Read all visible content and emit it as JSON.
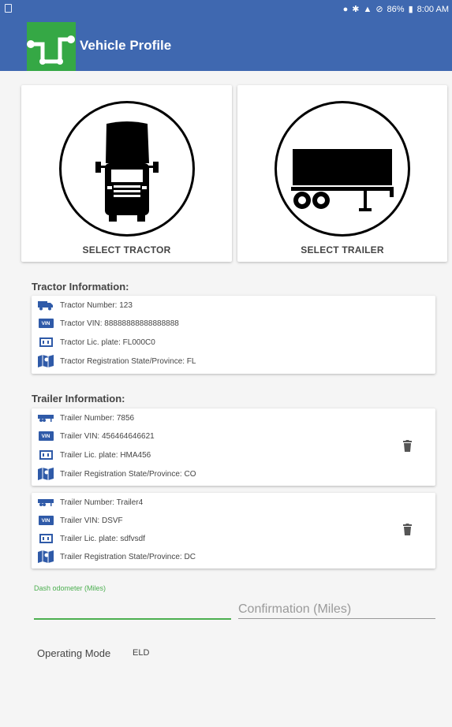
{
  "status_bar": {
    "battery_percent": "86%",
    "time": "8:00 AM",
    "icons": [
      "location-icon",
      "bluetooth-icon",
      "wifi-icon",
      "do-not-disturb-icon",
      "battery-icon"
    ]
  },
  "app_bar": {
    "title": "Vehicle Profile"
  },
  "selectors": {
    "tractor_label": "SELECT TRACTOR",
    "trailer_label": "SELECT TRAILER"
  },
  "tractor_info": {
    "heading": "Tractor Information:",
    "number": "Tractor Number: 123",
    "vin": "Tractor VIN: 88888888888888888",
    "plate": "Tractor Lic. plate: FL000C0",
    "state": "Tractor Registration State/Province: FL"
  },
  "trailer_info": {
    "heading": "Trailer Information:",
    "trailers": [
      {
        "number": "Trailer Number: 7856",
        "vin": "Trailer VIN: 456464646621",
        "plate": "Trailer Lic. plate: HMA456",
        "state": "Trailer Registration State/Province: CO"
      },
      {
        "number": "Trailer Number: Trailer4",
        "vin": "Trailer VIN: DSVF",
        "plate": "Trailer Lic. plate: sdfvsdf",
        "state": "Trailer Registration State/Province: DC"
      }
    ]
  },
  "icon_labels": {
    "vin": "VIN"
  },
  "odometer": {
    "label": "Dash odometer (Miles)",
    "value": "",
    "confirmation_placeholder": "Confirmation (Miles)"
  },
  "operating_mode": {
    "label": "Operating Mode",
    "value": "ELD"
  },
  "colors": {
    "app_bar": "#3f68b0",
    "logo": "#35a845",
    "accent_green": "#4caf50",
    "icon_blue": "#2f5aa8"
  }
}
